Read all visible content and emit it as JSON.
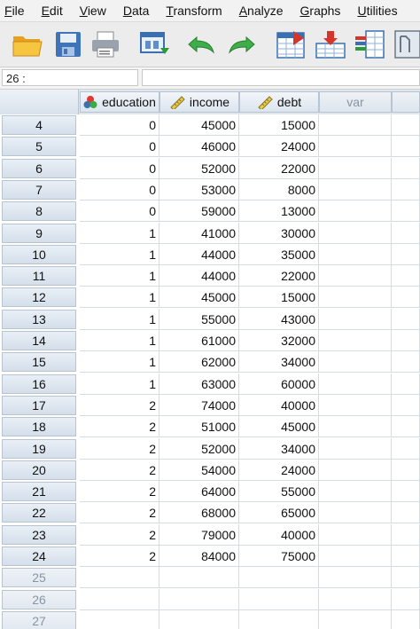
{
  "menu": [
    "File",
    "Edit",
    "View",
    "Data",
    "Transform",
    "Analyze",
    "Graphs",
    "Utilities"
  ],
  "toolbar": {
    "icons": [
      "open-folder-icon",
      "save-icon",
      "print-icon",
      "dialog-recall-icon",
      "undo-icon",
      "redo-icon",
      "goto-case-icon",
      "insert-cases-icon",
      "variables-icon",
      "split-file-icon"
    ]
  },
  "editor": {
    "cell_ref": "26 :",
    "cell_value": ""
  },
  "grid": {
    "columns": [
      {
        "label": "education",
        "icon": "nominal-measure-icon"
      },
      {
        "label": "income",
        "icon": "scale-ruler-icon"
      },
      {
        "label": "debt",
        "icon": "scale-ruler-icon"
      },
      {
        "label": "var",
        "icon": ""
      }
    ],
    "rows": [
      {
        "n": "4",
        "education": "0",
        "income": "45000",
        "debt": "15000"
      },
      {
        "n": "5",
        "education": "0",
        "income": "46000",
        "debt": "24000"
      },
      {
        "n": "6",
        "education": "0",
        "income": "52000",
        "debt": "22000"
      },
      {
        "n": "7",
        "education": "0",
        "income": "53000",
        "debt": "8000"
      },
      {
        "n": "8",
        "education": "0",
        "income": "59000",
        "debt": "13000"
      },
      {
        "n": "9",
        "education": "1",
        "income": "41000",
        "debt": "30000"
      },
      {
        "n": "10",
        "education": "1",
        "income": "44000",
        "debt": "35000"
      },
      {
        "n": "11",
        "education": "1",
        "income": "44000",
        "debt": "22000"
      },
      {
        "n": "12",
        "education": "1",
        "income": "45000",
        "debt": "15000"
      },
      {
        "n": "13",
        "education": "1",
        "income": "55000",
        "debt": "43000"
      },
      {
        "n": "14",
        "education": "1",
        "income": "61000",
        "debt": "32000"
      },
      {
        "n": "15",
        "education": "1",
        "income": "62000",
        "debt": "34000"
      },
      {
        "n": "16",
        "education": "1",
        "income": "63000",
        "debt": "60000"
      },
      {
        "n": "17",
        "education": "2",
        "income": "74000",
        "debt": "40000"
      },
      {
        "n": "18",
        "education": "2",
        "income": "51000",
        "debt": "45000"
      },
      {
        "n": "19",
        "education": "2",
        "income": "52000",
        "debt": "34000"
      },
      {
        "n": "20",
        "education": "2",
        "income": "54000",
        "debt": "24000"
      },
      {
        "n": "21",
        "education": "2",
        "income": "64000",
        "debt": "55000"
      },
      {
        "n": "22",
        "education": "2",
        "income": "68000",
        "debt": "65000"
      },
      {
        "n": "23",
        "education": "2",
        "income": "79000",
        "debt": "40000"
      },
      {
        "n": "24",
        "education": "2",
        "income": "84000",
        "debt": "75000"
      }
    ],
    "empty_rows": [
      "25",
      "26",
      "27"
    ]
  }
}
